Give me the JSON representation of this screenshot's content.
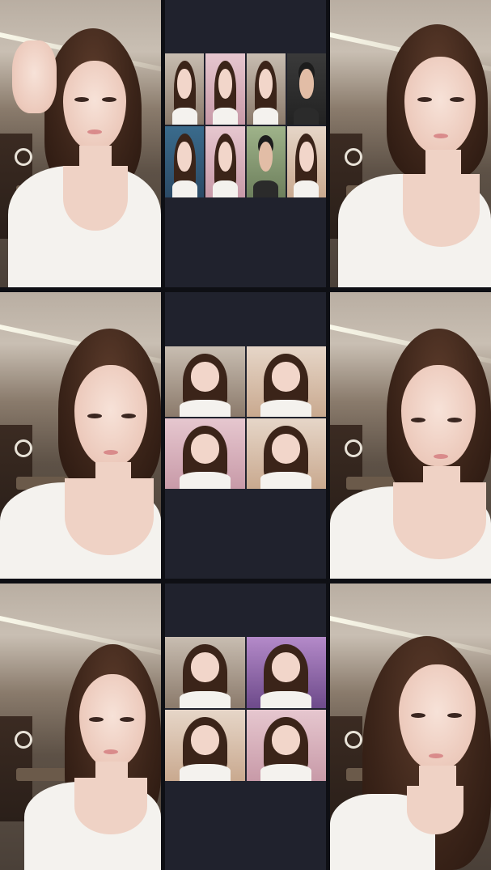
{
  "layout": {
    "rows": 3,
    "columns": 3
  },
  "streams": [
    {
      "row": 1,
      "position": "left",
      "subject": "woman-white-top"
    },
    {
      "row": 1,
      "position": "middle",
      "tiles": 8
    },
    {
      "row": 1,
      "position": "right",
      "subject": "woman-white-top"
    },
    {
      "row": 2,
      "position": "left",
      "subject": "woman-white-top"
    },
    {
      "row": 2,
      "position": "middle",
      "tiles": 4
    },
    {
      "row": 2,
      "position": "right",
      "subject": "woman-white-top"
    },
    {
      "row": 3,
      "position": "left",
      "subject": "woman-white-top"
    },
    {
      "row": 3,
      "position": "middle",
      "tiles": 4
    },
    {
      "row": 3,
      "position": "right",
      "subject": "woman-white-top"
    }
  ],
  "colors": {
    "divider": "#0e0f14",
    "middle_panel": "#20222d",
    "hair": "#3b2419",
    "skin": "#f2d6ca",
    "shirt": "#f4f2ee"
  }
}
